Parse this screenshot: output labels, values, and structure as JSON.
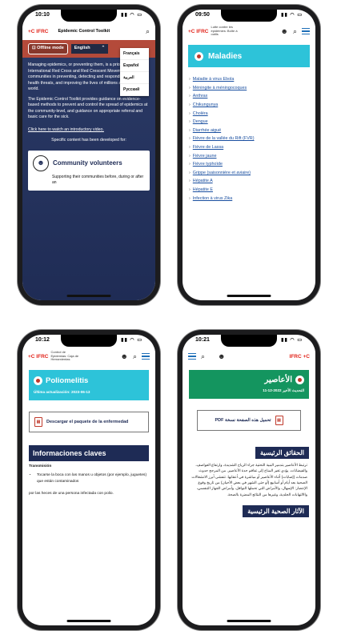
{
  "phone1": {
    "time": "10:10",
    "logo": "+C IFRC",
    "header_title": "Epidemic Control Toolkit",
    "offline_label": "Offline mode",
    "language_selected": "English",
    "languages": [
      "Français",
      "Español",
      "العربية",
      "Русский"
    ],
    "para1": "Managing epidemics, or preventing them, is a priority for the International Red Cross and Red Crescent Movement and communities in preventing, detecting and responding to local health threats, and improving the lives of millions around the world.",
    "para2": "The Epidemic Control Toolkit provides guidance on evidence-based methods to prevent and control the spread of epidemics at the community-level, and guidance on appropriate referral and basic care for the sick.",
    "video_link": "Click here to watch an introductory video.",
    "specific_text": "Specific content has been developed for:",
    "card_title": "Community volunteers",
    "card_text": "Supporting their communities before, during or after an"
  },
  "phone2": {
    "time": "09:50",
    "logo": "+C IFRC",
    "logo_sub": "Lutte contre les épidémies: Boîte à outils",
    "banner_title": "Maladies",
    "diseases": [
      "Maladie à virus Ebola",
      "Méningite à méningocoques",
      "Anthrax",
      "Chikungunya",
      "Choléra",
      "Dengue",
      "Diarrhée aiguë",
      "Fièvre de la vallée du Rift (FVR)",
      "Fièvre de Lassa",
      "Fièvre jaune",
      "Fièvre typhoïde",
      "Grippe (saisonnière et aviaire)",
      "Hépatite A",
      "Hépatite E",
      "Infection à virus Zika"
    ]
  },
  "phone3": {
    "time": "10:12",
    "logo": "+C IFRC",
    "logo_sub": "Control de Epidemias: Caja de Herramientas",
    "banner_title": "Poliomelitis",
    "updated": "Última actualización: 2023-06-13",
    "download_label": "Descargar el paquete de la enfermedad",
    "keyfacts_title": "Informaciones claves",
    "transmission_label": "Transmisión",
    "bullet1": "Tocarse la boca con las manos u objetos (por ejemplo, juguetes) que están contaminados",
    "bullet2": "por las heces de una persona infectada con polio."
  },
  "phone4": {
    "time": "10:21",
    "logo": "IFRC +C",
    "banner_title": "الأعاصير",
    "updated": "التحديث الأخير 2022-12-11",
    "download_label": "تحميل هذه الصفحة نسخة PDF",
    "keyfacts_title": "الحقائق الرئيسية",
    "text": "ترتبط الأعاصير بتدمير البنية التحتية جراء الرياح الشديدة، وارتفاع العواصف، والفيضانات. يؤدي تغير المناخ إلى تفاقم حدة الأعاصير. من المرجح حدوث صدمات (إصابات) أثناء الأعاصير أو مباشرة في أعقابها. تتفشى أبرز الانشغالات الصحية بعد أيام أو أسابيع (أو حتى الشهر في بعض الأحيان) من تاريخ وقوع الإعصار: الإسهال، والأمراض التي تحملها النواقل، وأمراض الجهاز التنفسي، والالتهابات الجلدية، وغيرها من النتائج المضرة بالصحة.",
    "health_title": "الآثار الصحية الرئيسية"
  },
  "colors": {
    "ifrc_red": "#e2231a",
    "teal": "#2dc3d9",
    "navy": "#1e2b55",
    "green": "#14955f"
  }
}
